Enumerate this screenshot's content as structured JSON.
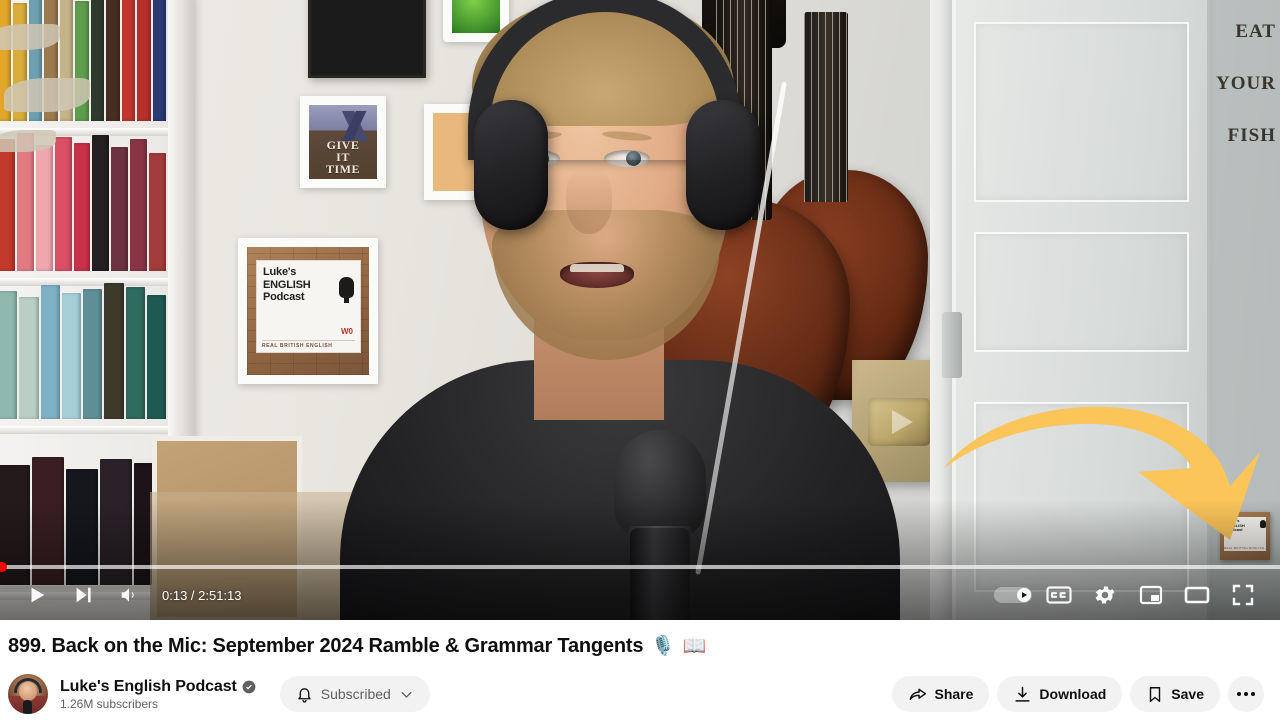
{
  "player": {
    "time_display": "0:13 / 2:51:13",
    "current_time": "0:13",
    "duration": "2:51:13",
    "progress_percent": 0.13,
    "buffer_percent": 100,
    "controls": {
      "play": "Play",
      "next": "Next",
      "volume": "Mute",
      "autoplay": "Autoplay is on",
      "subtitles": "Subtitles/closed captions (c)",
      "settings": "Settings",
      "miniplayer": "Miniplayer (i)",
      "theater": "Theater mode (t)",
      "fullscreen": "Full screen (f)"
    },
    "annotation": {
      "arrow_color": "#fbc55a",
      "arrow_color_dark": "#f6c445"
    },
    "scene": {
      "posters": [
        {
          "name": "give-it-time",
          "text": "GIVE\nIT\nTIME"
        },
        {
          "name": "lukes-english-podcast",
          "title": "Luke's\nENGLISH\nPodcast",
          "badge": "W0",
          "subtitle": "REAL BRITISH ENGLISH"
        },
        {
          "name": "eat-your-fish",
          "lines": [
            "EAT",
            "YOUR",
            "FISH"
          ]
        }
      ],
      "mini_poster": {
        "title": "Luke's\nENGLISH\nPodcast",
        "subtitle": "REAL BRITISH ENGLISH"
      }
    }
  },
  "video": {
    "title": "899. Back on the Mic: September 2024 Ramble & Grammar Tangents",
    "title_emoji_mic": "🎙️",
    "title_emoji_book": "📖"
  },
  "channel": {
    "name": "Luke's English Podcast",
    "subscribers": "1.26M subscribers",
    "verified": true,
    "subscribe_label": "Subscribed"
  },
  "actions": [
    {
      "name": "share",
      "label": "Share"
    },
    {
      "name": "download",
      "label": "Download"
    },
    {
      "name": "save",
      "label": "Save"
    }
  ],
  "colors": {
    "accent_red": "#ff0000",
    "chip_bg": "#f2f2f2",
    "text_primary": "#0f0f0f",
    "text_secondary": "#606060"
  }
}
